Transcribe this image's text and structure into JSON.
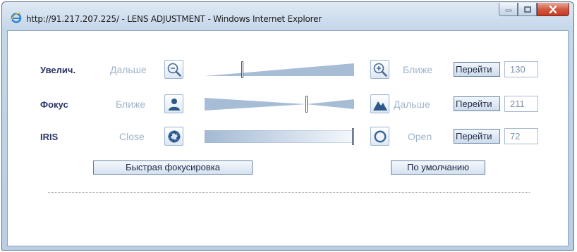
{
  "window": {
    "title": "http://91.217.207.225/ - LENS ADJUSTMENT - Windows Internet Explorer"
  },
  "controls": [
    {
      "id": "zoom",
      "label": "Увелич.",
      "left_text": "Дальше",
      "right_text": "Ближе",
      "left_icon": "zoom-out-icon",
      "right_icon": "zoom-in-icon",
      "go_label": "Перейти",
      "value": "130",
      "slider_position": 0.25,
      "track_shape": "wedge-increasing"
    },
    {
      "id": "focus",
      "label": "Фокус",
      "left_text": "Ближе",
      "right_text": "Дальше",
      "left_icon": "person-icon",
      "right_icon": "mountain-icon",
      "go_label": "Перейти",
      "value": "211",
      "slider_position": 0.68,
      "track_shape": "bowtie"
    },
    {
      "id": "iris",
      "label": "IRIS",
      "left_text": "Close",
      "right_text": "Open",
      "left_icon": "iris-closed-icon",
      "right_icon": "iris-open-icon",
      "go_label": "Перейти",
      "value": "72",
      "slider_position": 0.99,
      "track_shape": "gradient"
    }
  ],
  "actions": {
    "quick_focus": "Быстрая фокусировка",
    "default": "По умолчанию"
  },
  "colors": {
    "label": "#2b3566",
    "muted_text": "#9fb3cc",
    "track": "#a7bdd6",
    "button_border": "#5d7ea3"
  }
}
